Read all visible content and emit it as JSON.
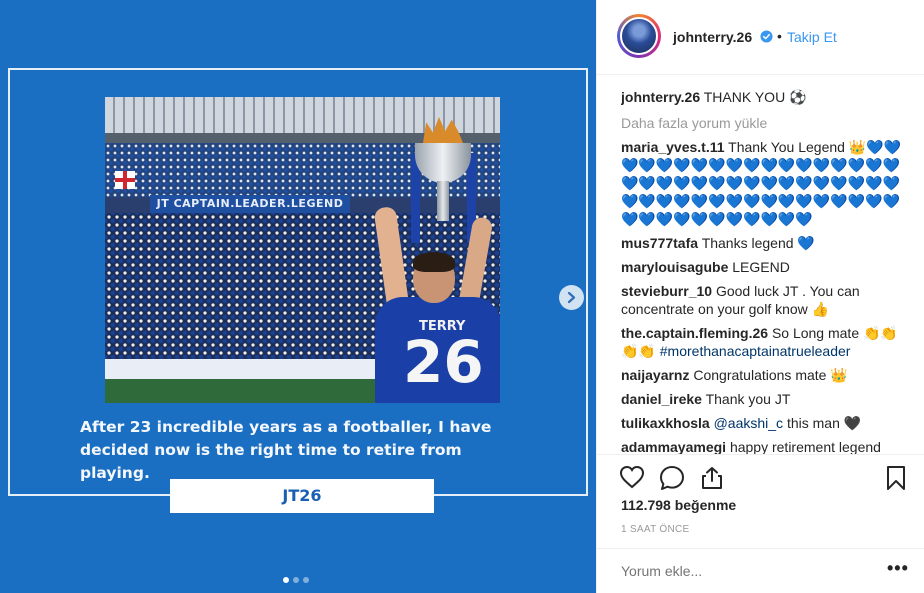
{
  "post": {
    "banner_text": "JT CAPTAIN.LEADER.LEGEND",
    "shirt_name": "TERRY",
    "shirt_number": "26",
    "caption": "After 23 incredible years as a footballer, I have decided now is the right time to retire from playing.",
    "tag": "JT26",
    "carousel": {
      "current": 1,
      "total": 3
    }
  },
  "header": {
    "username": "johnterry.26",
    "separator": "•",
    "follow_label": "Takip Et"
  },
  "comments": {
    "caption": {
      "user": "johnterry.26",
      "text": "THANK YOU ⚽"
    },
    "load_more": "Daha fazla yorum yükle",
    "items": [
      {
        "user": "maria_yves.t.11",
        "text": "Thank You Legend 👑💙💙💙💙💙💙💙💙💙💙💙💙💙💙💙💙💙💙💙💙💙💙💙💙💙💙💙💙💙💙💙💙💙💙💙💙💙💙💙💙💙💙💙💙💙💙💙💙💙💙💙💙💙💙💙💙💙💙💙💙💙"
      },
      {
        "user": "mus777tafa",
        "text": "Thanks legend 💙"
      },
      {
        "user": "marylouisagube",
        "text": "LEGEND"
      },
      {
        "user": "stevieburr_10",
        "text": "Good luck JT . You can concentrate on your golf know 👍"
      },
      {
        "user": "the.captain.fleming.26",
        "text": "So Long mate 👏👏👏👏",
        "link": "#morethanacaptainatrueleader"
      },
      {
        "user": "naijayarnz",
        "text": "Congratulations mate 👑"
      },
      {
        "user": "daniel_ireke",
        "text": "Thank you JT"
      },
      {
        "user": "tulikaxkhosla",
        "mention": "@aakshi_c",
        "text": " this man 🖤"
      },
      {
        "user": "adammayamegi",
        "text": "happy retirement legend"
      }
    ]
  },
  "engagement": {
    "likes": "112.798 beğenme",
    "time": "1 SAAT ÖNCE"
  },
  "add_comment": {
    "placeholder": "Yorum ekle...",
    "more": "•••"
  },
  "colors": {
    "post_background": "#1a6fc2",
    "link": "#3897f0",
    "verified": "#3897f0"
  }
}
